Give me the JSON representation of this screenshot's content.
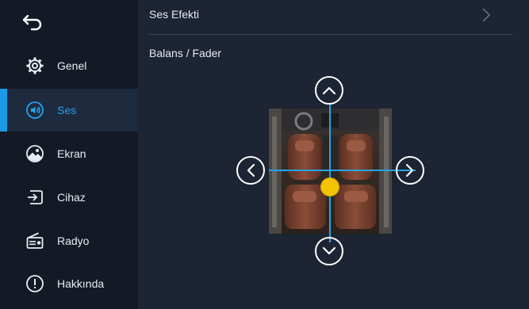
{
  "sidebar": {
    "items": [
      {
        "label": "Genel",
        "icon": "gear-icon"
      },
      {
        "label": "Ses",
        "icon": "speaker-icon",
        "active": true
      },
      {
        "label": "Ekran",
        "icon": "display-icon"
      },
      {
        "label": "Cihaz",
        "icon": "device-input-icon"
      },
      {
        "label": "Radyo",
        "icon": "radio-icon"
      },
      {
        "label": "Hakkında",
        "icon": "info-icon"
      }
    ]
  },
  "main": {
    "row_title": "Ses Efekti",
    "section_title": "Balans / Fader"
  },
  "colors": {
    "accent": "#22a3ee",
    "knob": "#f5c400",
    "background": "#1d2433",
    "sidebar": "#141a25"
  }
}
